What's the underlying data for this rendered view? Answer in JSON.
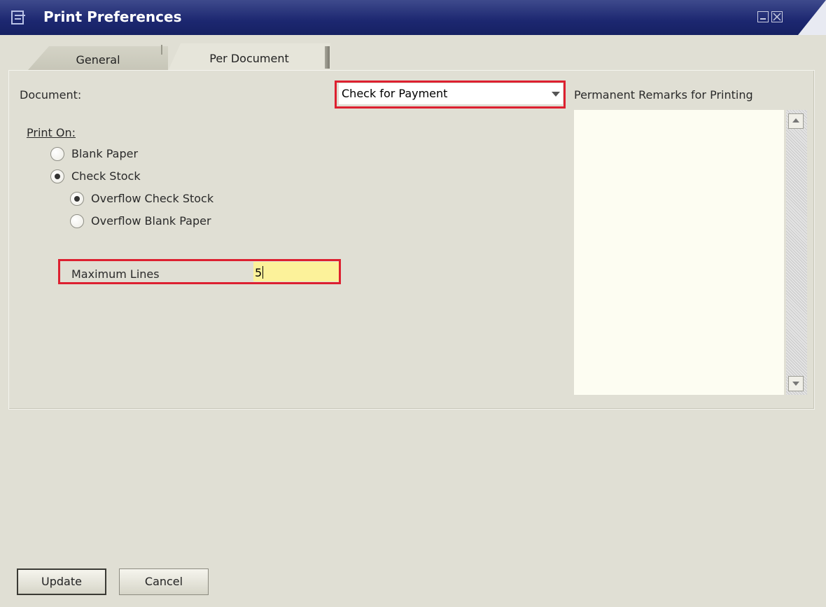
{
  "window": {
    "title": "Print Preferences",
    "icons": {
      "app": "document-pen-icon",
      "minimize": "minimize-icon",
      "close": "close-icon"
    }
  },
  "tabs": [
    {
      "label": "General",
      "active": false
    },
    {
      "label": "Per Document",
      "active": true
    }
  ],
  "document": {
    "label": "Document:",
    "selected": "Check for Payment",
    "dropdown_icon": "chevron-down-icon"
  },
  "print_on": {
    "label": "Print On:",
    "options": [
      {
        "label": "Blank Paper",
        "checked": false
      },
      {
        "label": "Check Stock",
        "checked": true
      },
      {
        "label": "Overflow Check Stock",
        "checked": true
      },
      {
        "label": "Overflow Blank Paper",
        "checked": false
      }
    ]
  },
  "max_lines": {
    "label": "Maximum Lines",
    "value": "5"
  },
  "remarks": {
    "label": "Permanent Remarks for Printing",
    "value": ""
  },
  "buttons": {
    "update": "Update",
    "cancel": "Cancel"
  },
  "colors": {
    "titlebar": "#1c2770",
    "dialog_bg": "#e0dfd4",
    "highlight": "#dd2030",
    "input_highlight": "#fcf29a",
    "remarks_bg": "#fdfdf2"
  }
}
